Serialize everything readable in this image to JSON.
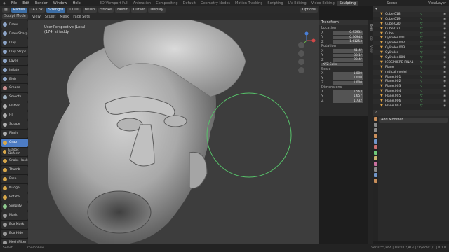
{
  "topbar": {
    "menus": [
      "File",
      "Edit",
      "Render",
      "Window",
      "Help"
    ],
    "workspaces": [
      "3D Viewport Full",
      "Animation",
      "Compositing",
      "Default",
      "Geometry Nodes",
      "Motion Tracking",
      "Scripting",
      "UV Editing",
      "Video Editing",
      "Sculpting"
    ],
    "active_workspace": "Sculpting",
    "scene_label": "Scene",
    "view_layer_label": "ViewLayer"
  },
  "header": {
    "mode": "Sculpt Mode",
    "chips": [
      "Radius",
      "Strength",
      "Brush",
      "Stroke",
      "Falloff",
      "Cursor",
      "Display"
    ],
    "menus": [
      "View",
      "Sculpt",
      "Mask",
      "Face Sets"
    ],
    "options_label": "Options"
  },
  "viewport": {
    "line1": "User Perspective (Local)",
    "line2": "(174) sirfaddy"
  },
  "tools": [
    {
      "label": "Draw",
      "color": "#8ea6c9",
      "active": false
    },
    {
      "label": "Draw Sharp",
      "color": "#8ea6c9",
      "active": false
    },
    {
      "label": "Clay",
      "color": "#8ea6c9",
      "active": false
    },
    {
      "label": "Clay Strips",
      "color": "#8ea6c9",
      "active": false
    },
    {
      "label": "Layer",
      "color": "#8ea6c9",
      "active": false
    },
    {
      "label": "Inflate",
      "color": "#8ea6c9",
      "active": false
    },
    {
      "label": "Blob",
      "color": "#8ea6c9",
      "active": false
    },
    {
      "label": "Crease",
      "color": "#c98e8e",
      "active": false
    },
    {
      "label": "Smooth",
      "color": "#9fb0c0",
      "active": false
    },
    {
      "label": "Flatten",
      "color": "#b0b0b0",
      "active": false
    },
    {
      "label": "Fill",
      "color": "#b0b0b0",
      "active": false
    },
    {
      "label": "Scrape",
      "color": "#b0b0b0",
      "active": false
    },
    {
      "label": "Pinch",
      "color": "#b0b0b0",
      "active": false
    },
    {
      "label": "Grab",
      "color": "#d8a84a",
      "active": true
    },
    {
      "label": "Elastic Deform",
      "color": "#d8a84a",
      "active": false
    },
    {
      "label": "Snake Hook",
      "color": "#d8a84a",
      "active": false
    },
    {
      "label": "Thumb",
      "color": "#d8a84a",
      "active": false
    },
    {
      "label": "Pose",
      "color": "#d8a84a",
      "active": false
    },
    {
      "label": "Nudge",
      "color": "#d8a84a",
      "active": false
    },
    {
      "label": "Rotate",
      "color": "#d8a84a",
      "active": false
    },
    {
      "label": "Simplify",
      "color": "#8ec98e",
      "active": false
    },
    {
      "label": "Mask",
      "color": "#9a9a9a",
      "active": false
    },
    {
      "label": "Box Mask",
      "color": "#9a9a9a",
      "active": false
    },
    {
      "label": "Box Hide",
      "color": "#9a9a9a",
      "active": false
    },
    {
      "label": "Mesh Filter",
      "color": "#9a9a9a",
      "active": false
    }
  ],
  "transform": {
    "title": "Transform",
    "location_label": "Location",
    "location": [
      {
        "axis": "X",
        "value": "0.95932"
      },
      {
        "axis": "Y",
        "value": "0.36945"
      },
      {
        "axis": "Z",
        "value": "1.61253"
      }
    ],
    "rotation_label": "Rotation",
    "rotation": [
      {
        "axis": "X",
        "value": "41.4°"
      },
      {
        "axis": "Y",
        "value": "38.1°"
      },
      {
        "axis": "Z",
        "value": "98.4°"
      }
    ],
    "mode_value": "XYZ Euler",
    "scale_label": "Scale",
    "scale": [
      {
        "axis": "X",
        "value": "1.000"
      },
      {
        "axis": "Y",
        "value": "1.000"
      },
      {
        "axis": "Z",
        "value": "1.000"
      }
    ],
    "dimensions_label": "Dimensions",
    "dimensions": [
      {
        "axis": "X",
        "value": "1.563"
      },
      {
        "axis": "Y",
        "value": "1.657"
      },
      {
        "axis": "Z",
        "value": "1.732"
      }
    ]
  },
  "npanel_tabs": [
    "Item",
    "Tool",
    "View"
  ],
  "outliner": {
    "rows": [
      {
        "name": "Cube.018"
      },
      {
        "name": "Cube.019"
      },
      {
        "name": "Cube.020"
      },
      {
        "name": "Cube.021"
      },
      {
        "name": "Cube"
      },
      {
        "name": "Cylinder.001"
      },
      {
        "name": "Cylinder.002"
      },
      {
        "name": "Cylinder.003"
      },
      {
        "name": "Cylinder"
      },
      {
        "name": "Cylinder.004"
      },
      {
        "name": "ICOSPHERE FINAL"
      },
      {
        "name": "Plane"
      },
      {
        "name": "radical model"
      },
      {
        "name": "Plane.001"
      },
      {
        "name": "Plane.002"
      },
      {
        "name": "Plane.003"
      },
      {
        "name": "Plane.004"
      },
      {
        "name": "Plane.005"
      },
      {
        "name": "Plane.006"
      },
      {
        "name": "Plane.007"
      }
    ]
  },
  "properties": {
    "object_name": "Add Modifier",
    "search_placeholder": ""
  },
  "statusbar": {
    "left": "Select",
    "mid": "Zoom View",
    "right": "Verts:55,864 | Tris:112,814 | Objects:1/1 | 4.1.0"
  },
  "colors": {
    "accent": "#4d7cc4",
    "brush_circle": "#57c26a",
    "outliner_icon": "#e0a447",
    "mesh_icon": "#59c26b"
  }
}
